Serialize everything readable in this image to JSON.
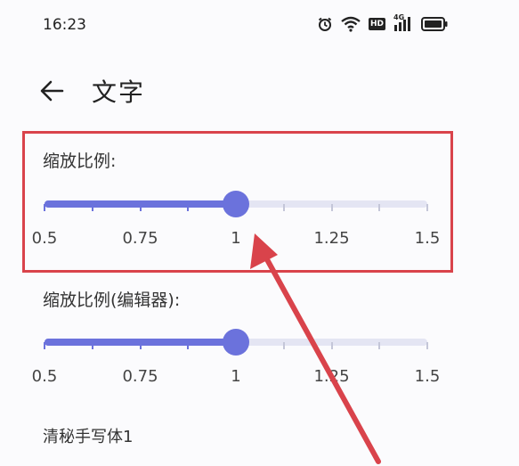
{
  "status_bar": {
    "time": "16:23",
    "icons": [
      "alarm-icon",
      "wifi-icon",
      "hd-icon",
      "signal-4g-icon",
      "battery-icon"
    ],
    "hd_label": "HD",
    "network_label": "4G"
  },
  "header": {
    "back_icon": "back-arrow-icon",
    "title": "文字"
  },
  "settings": [
    {
      "label": "缩放比例:",
      "min": 0.5,
      "max": 1.5,
      "value": 1,
      "tick_labels": [
        "0.5",
        "0.75",
        "1",
        "1.25",
        "1.5"
      ]
    },
    {
      "label": "缩放比例(编辑器):",
      "min": 0.5,
      "max": 1.5,
      "value": 1,
      "tick_labels": [
        "0.5",
        "0.75",
        "1",
        "1.25",
        "1.5"
      ]
    }
  ],
  "next_setting_label": "清秘手写体1",
  "colors": {
    "accent": "#6b72dc",
    "track_inactive": "#e4e5f3",
    "highlight": "#d9434b"
  }
}
